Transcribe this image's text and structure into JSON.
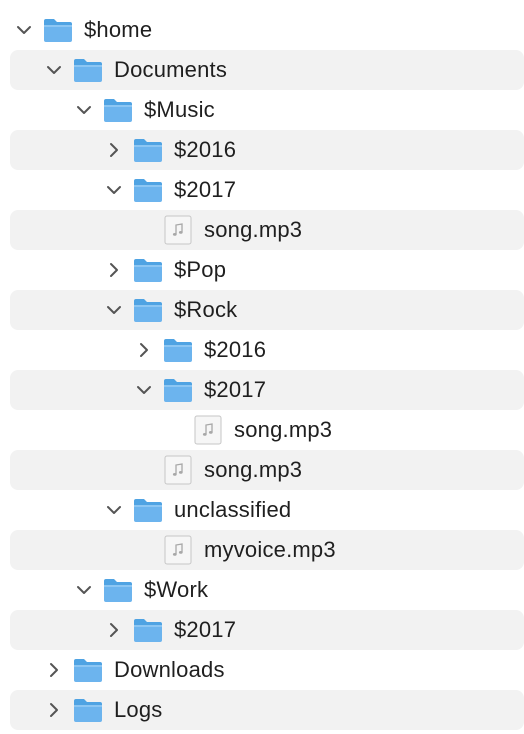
{
  "tree": {
    "items": [
      {
        "label": "$home",
        "icon": "folder-icon",
        "toggle": "expanded"
      },
      {
        "label": "Documents",
        "icon": "folder-icon",
        "toggle": "expanded"
      },
      {
        "label": "$Music",
        "icon": "folder-icon",
        "toggle": "expanded"
      },
      {
        "label": "$2016",
        "icon": "folder-icon",
        "toggle": "collapsed"
      },
      {
        "label": "$2017",
        "icon": "folder-icon",
        "toggle": "expanded"
      },
      {
        "label": "song.mp3",
        "icon": "audio-file-icon",
        "toggle": "none"
      },
      {
        "label": "$Pop",
        "icon": "folder-icon",
        "toggle": "collapsed"
      },
      {
        "label": "$Rock",
        "icon": "folder-icon",
        "toggle": "expanded"
      },
      {
        "label": "$2016",
        "icon": "folder-icon",
        "toggle": "collapsed"
      },
      {
        "label": "$2017",
        "icon": "folder-icon",
        "toggle": "expanded"
      },
      {
        "label": "song.mp3",
        "icon": "audio-file-icon",
        "toggle": "none"
      },
      {
        "label": "song.mp3",
        "icon": "audio-file-icon",
        "toggle": "none"
      },
      {
        "label": "unclassified",
        "icon": "folder-icon",
        "toggle": "expanded"
      },
      {
        "label": "myvoice.mp3",
        "icon": "audio-file-icon",
        "toggle": "none"
      },
      {
        "label": "$Work",
        "icon": "folder-icon",
        "toggle": "expanded"
      },
      {
        "label": "$2017",
        "icon": "folder-icon",
        "toggle": "collapsed"
      },
      {
        "label": "Downloads",
        "icon": "folder-icon",
        "toggle": "collapsed"
      },
      {
        "label": "Logs",
        "icon": "folder-icon",
        "toggle": "collapsed"
      }
    ]
  },
  "colors": {
    "row_alt_background": "#f2f2f2",
    "folder_blue": "#6cb4ee",
    "text": "#1f1f1f",
    "chevron": "#555555"
  }
}
